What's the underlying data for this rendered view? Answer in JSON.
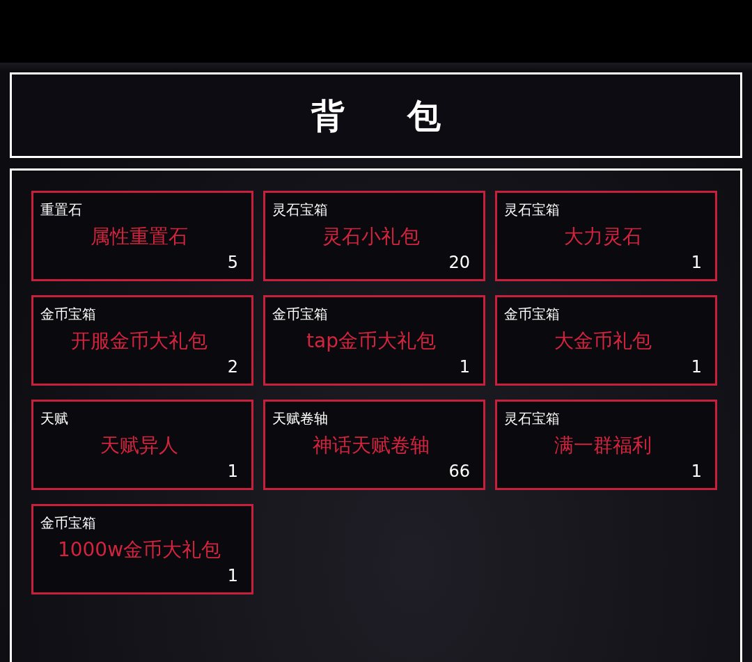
{
  "title": "背　包",
  "items": [
    {
      "category": "重置石",
      "name": "属性重置石",
      "count": "5"
    },
    {
      "category": "灵石宝箱",
      "name": "灵石小礼包",
      "count": "20"
    },
    {
      "category": "灵石宝箱",
      "name": "大力灵石",
      "count": "1"
    },
    {
      "category": "金币宝箱",
      "name": "开服金币大礼包",
      "count": "2"
    },
    {
      "category": "金币宝箱",
      "name": "tap金币大礼包",
      "count": "1"
    },
    {
      "category": "金币宝箱",
      "name": "大金币礼包",
      "count": "1"
    },
    {
      "category": "天赋",
      "name": "天赋异人",
      "count": "1"
    },
    {
      "category": "天赋卷轴",
      "name": "神话天赋卷轴",
      "count": "66"
    },
    {
      "category": "灵石宝箱",
      "name": "满一群福利",
      "count": "1"
    },
    {
      "category": "金币宝箱",
      "name": "1000w金币大礼包",
      "count": "1"
    }
  ]
}
